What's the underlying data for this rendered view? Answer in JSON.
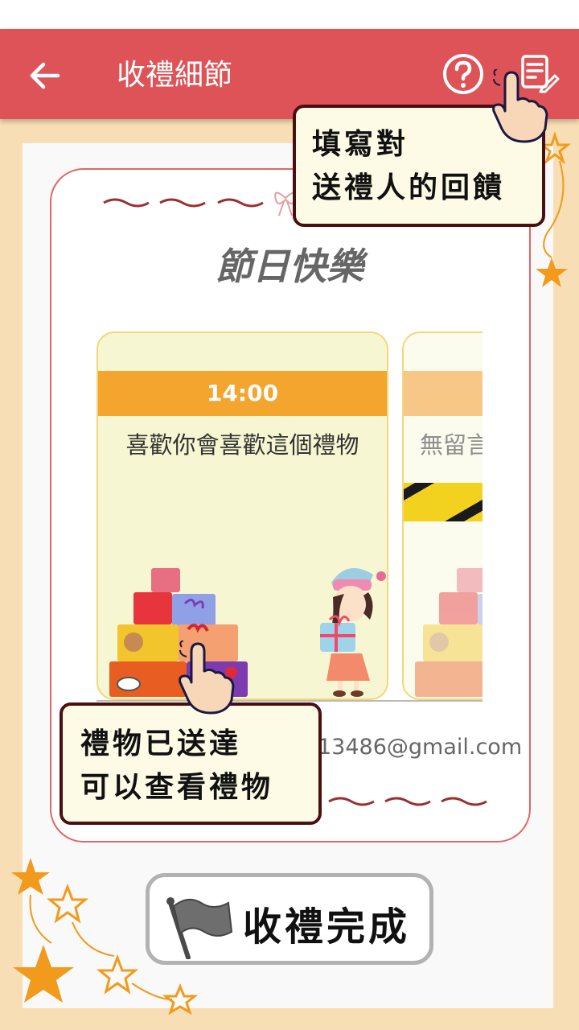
{
  "app_bar": {
    "title": "收禮細節",
    "back_icon": "arrow-left-icon",
    "help_icon": "help-circle-icon",
    "feedback_icon": "edit-note-icon"
  },
  "card": {
    "greeting": "節日快樂",
    "gifts": [
      {
        "time": "14:00",
        "message": "喜歡你會喜歡這個禮物"
      },
      {
        "time": "",
        "message": "無留言"
      }
    ],
    "sender_email": "13486@gmail.com"
  },
  "tips": {
    "feedback": [
      "填寫對",
      "送禮人的回饋"
    ],
    "gift_arrived": [
      "禮物已送達",
      "可以查看禮物"
    ]
  },
  "done_button": {
    "label": "收禮完成",
    "icon": "flag-icon"
  },
  "colors": {
    "app_bar": "#dd5358",
    "background": "#f8deb4",
    "time_band": "#f4a52e",
    "frame_border": "#e06868"
  }
}
